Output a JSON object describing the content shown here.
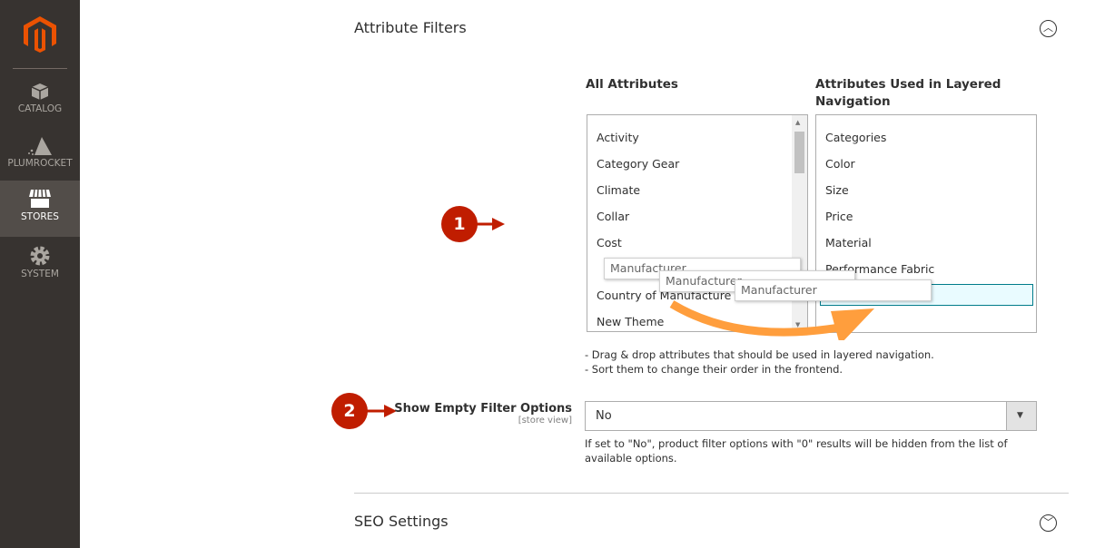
{
  "sidebar": {
    "items": [
      {
        "label": "CATALOG",
        "icon": "box-icon"
      },
      {
        "label": "PLUMROCKET",
        "icon": "plumrocket-icon"
      },
      {
        "label": "STORES",
        "icon": "store-icon",
        "active": true
      },
      {
        "label": "SYSTEM",
        "icon": "gear-icon"
      }
    ]
  },
  "attribute_filters": {
    "title": "Attribute Filters",
    "all_header": "All Attributes",
    "used_header": "Attributes Used in Layered Navigation",
    "all_items": [
      "Activity",
      "Category Gear",
      "Climate",
      "Collar",
      "Cost",
      "Country of Manufacture",
      "New Theme"
    ],
    "used_items": [
      "Categories",
      "Color",
      "Size",
      "Price",
      "Material",
      "Performance Fabric"
    ],
    "dragged_item": "Manufacturer",
    "notes": [
      "- Drag & drop attributes that should be used in layered navigation.",
      "- Sort them to change their order in the frontend."
    ]
  },
  "show_empty": {
    "label": "Show Empty Filter Options",
    "scope": "[store view]",
    "value": "No",
    "note": "If set to \"No\", product filter options with \"0\" results will be hidden from the list of available options."
  },
  "seo": {
    "title": "SEO Settings"
  },
  "annotations": [
    "1",
    "2"
  ],
  "colors": {
    "brand": "#eb5202",
    "badge": "#c01d00",
    "drag_arrow": "#ff9e3d",
    "drop_target": "#007b8a"
  }
}
